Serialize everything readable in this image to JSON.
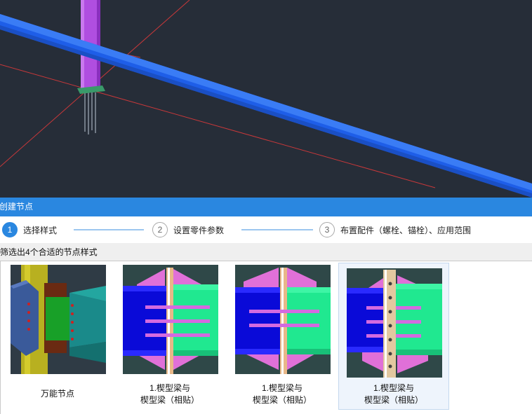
{
  "dialog": {
    "title": "创建节点"
  },
  "steps": [
    {
      "number": "1",
      "label": "选择样式",
      "active": true
    },
    {
      "number": "2",
      "label": "设置零件参数",
      "active": false
    },
    {
      "number": "3",
      "label": "布置配件（螺栓、锚栓）、应用范围",
      "active": false
    }
  ],
  "filter": {
    "text": "筛选出4个合适的节点样式"
  },
  "nodes": [
    {
      "line1": "万能节点",
      "line2": "",
      "selected": false
    },
    {
      "line1": "1.楔型梁与",
      "line2": "楔型梁（相贴）",
      "selected": false
    },
    {
      "line1": "1.楔型梁与",
      "line2": "楔型梁（相贴）",
      "selected": false
    },
    {
      "line1": "1.楔型梁与",
      "line2": "楔型梁（相贴）",
      "selected": true
    }
  ],
  "colors": {
    "accent": "#2a87e0",
    "viewport_bg": "#262d38",
    "beam": "#1e5ee8",
    "column": "#b04ee0"
  }
}
